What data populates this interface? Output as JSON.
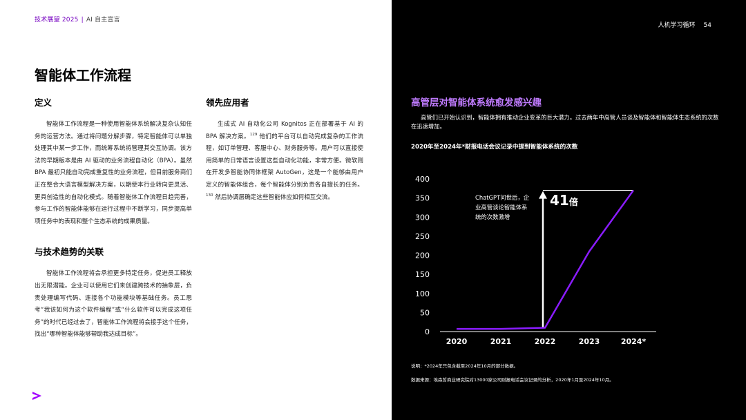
{
  "header": {
    "report": "技术展望 2025",
    "separator": "|",
    "section": "AI 自主宣言",
    "chapter": "人机学习循环",
    "page_number": "54"
  },
  "page_title": "智能体工作流程",
  "definition": {
    "heading": "定义",
    "body": "智能体工作流程是一种使用智能体系统解决复杂认知任务的运营方法。通过将问题分解步骤，特定智能体可以单独处理其中某一步工作，而统筹系统将管理其交互协调。该方法的早期版本是由 AI 驱动的业务流程自动化（BPA）。虽然 BPA 最初只能自动完成重复性的业务流程，但目前服务商们正在整合大语言模型解决方案，以期使本行业转向更灵活、更具创造性的自动化模式。随着智能体工作流程日趋完善，参与工作的智能体能够在运行过程中不断学习，同步提高单项任务中的表现和整个生态系统的成果质量。"
  },
  "relation": {
    "heading": "与技术趋势的关联",
    "body": "智能体工作流程将会承担更多特定任务，促进员工释放出无限潜能。企业可以使用它们来创建跨技术的抽象层，负责处理编写代码、连接各个功能模块等基础任务。员工思考“我该如何为这个软件编程”或“什么软件可以完成这项任务”的时代已经过去了，智能体工作流程将会接手这个任务，找出“哪种智能体能够帮助我达成目标”。"
  },
  "leading_apps": {
    "heading": "领先应用者",
    "body_part1": "生成式 AI 自动化公司 Kognitos 正在部署基于 AI 的 BPA 解决方案。",
    "ref1": "129",
    "body_part2": " 他们的平台可以自动完成复杂的工作流程，如订单管理、客服中心、财务服务等。用户可以直接使用简单的日常语言设置这些自动化功能，非常方便。微软则在开发多智能协同体框架 AutoGen，这是一个能够由用户定义的智能体组合，每个智能体分别负责各自擅长的任务。",
    "ref2": "130",
    "body_part3": " 然后协调层确定这些智能体应如何相互交流。"
  },
  "chart_panel": {
    "title": "高管层对智能体系统愈发感兴趣",
    "intro": "高管们已开始认识到，智能体拥有推动企业变革的巨大潜力。过去两年中高管人员谈及智能体和智能体生态系统的次数在迅速增加。",
    "subtitle": "2020年至2024年*财报电话会议记录中提到智能体系统的次数",
    "annotation": "ChatGPT问世后，企业高管谈论智能体系统的次数激增",
    "multiplier_value": "41",
    "multiplier_unit": "倍",
    "footnote": "说明：*2024年只包含截至2024年10月的部分数据。",
    "source": "数据来源：埃森哲商业研究院对13000家公司财报电话会议记录的分析，2020年1月至2024年10月。"
  },
  "chart_data": {
    "type": "line",
    "title": "2020年至2024年*财报电话会议记录中提到智能体系统的次数",
    "x": [
      "2020",
      "2021",
      "2022",
      "2023",
      "2024*"
    ],
    "series": [
      {
        "values": [
          7,
          7,
          10,
          210,
          370
        ]
      }
    ],
    "ylim": [
      0,
      400
    ],
    "yticks": [
      0,
      50,
      100,
      150,
      200,
      250,
      300,
      350,
      400
    ],
    "grid": false,
    "annotation": "ChatGPT问世后，企业高管谈论智能体系统的次数激增",
    "callout": "41倍",
    "colors": {
      "line": "#8a1cff",
      "background": "#000000",
      "text": "#ffffff"
    }
  },
  "colors": {
    "accent": "#7500c0",
    "accent_light": "#c07bff"
  }
}
